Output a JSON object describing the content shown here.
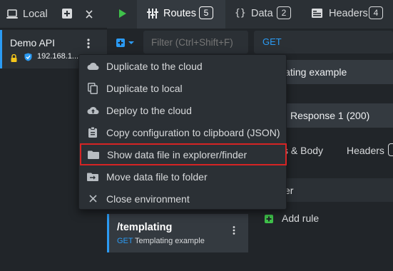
{
  "environments": {
    "local_label": "Local",
    "items": [
      {
        "name": "Demo API",
        "address": "192.168.1...."
      }
    ]
  },
  "tabs": [
    {
      "label": "Routes",
      "count": "5"
    },
    {
      "label": "Data",
      "count": "2"
    },
    {
      "label": "Headers",
      "count": "4"
    }
  ],
  "routes": {
    "filter_placeholder": "Filter (Ctrl+Shift+F)",
    "items": [
      {
        "path": "/templating",
        "method": "GET",
        "description": "Templating example"
      }
    ]
  },
  "route_editor": {
    "method": "GET",
    "endpoint_partial": "lating example",
    "response_label": "Response 1 (200)",
    "subtab_body": "s & Body",
    "subtab_headers": "Headers",
    "rules_partial": "er",
    "add_rule": "Add rule"
  },
  "context_menu": {
    "items": [
      {
        "label": "Duplicate to the cloud",
        "icon": "cloud-icon"
      },
      {
        "label": "Duplicate to local",
        "icon": "copy-icon"
      },
      {
        "label": "Deploy to the cloud",
        "icon": "cloud-upload-icon"
      },
      {
        "label": "Copy configuration to clipboard (JSON)",
        "icon": "clipboard-icon"
      },
      {
        "label": "Show data file in explorer/finder",
        "icon": "folder-icon",
        "highlighted": true
      },
      {
        "label": "Move data file to folder",
        "icon": "folder-move-icon"
      },
      {
        "label": "Close environment",
        "icon": "close-icon"
      }
    ]
  },
  "colors": {
    "accent": "#2b9bf4",
    "play": "#3fc14a",
    "warning_lock": "#f4c51a",
    "highlight_border": "#d62424"
  }
}
